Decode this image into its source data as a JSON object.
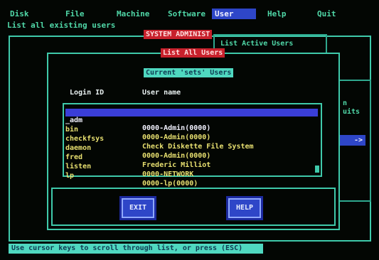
{
  "menu": {
    "items": [
      {
        "label": "Disk"
      },
      {
        "label": "File"
      },
      {
        "label": "Machine"
      },
      {
        "label": "Software"
      },
      {
        "label": "User"
      },
      {
        "label": "Help"
      },
      {
        "label": "Quit"
      }
    ],
    "active": "User"
  },
  "hint": "List all existing users",
  "sysadmin_title": "SYSTEM ADMINIST",
  "active_users_title": "List Active Users",
  "right_fragments": {
    "a": "n",
    "b": "uits"
  },
  "arrow_label": "->",
  "dialog": {
    "title": "List All Users",
    "current_label": "Current 'sets' Users",
    "headers": {
      "login": "Login ID",
      "name": "User name"
    },
    "rows": [
      {
        "login": "_adm",
        "name": "0000-Admin(0000)"
      },
      {
        "login": "bin",
        "name": "0000-Admin(0000)"
      },
      {
        "login": "checkfsys",
        "name": "Check Diskette File System"
      },
      {
        "login": "daemon",
        "name": "0000-Admin(0000)"
      },
      {
        "login": "fred",
        "name": "Frederic Milliot"
      },
      {
        "login": "listen",
        "name": "0000-NETWORK"
      },
      {
        "login": "lp",
        "name": "0000-lp(0000)"
      }
    ],
    "selected_index": 0,
    "buttons": {
      "exit": "EXIT",
      "help": "HELP"
    }
  },
  "status_line": "Use cursor keys to scroll through list, or press (ESC)",
  "colors": {
    "accent": "#3fc9aa",
    "selection": "#3a3ed8",
    "title_bar": "#c8212c",
    "status_bg": "#4fd8c0"
  }
}
